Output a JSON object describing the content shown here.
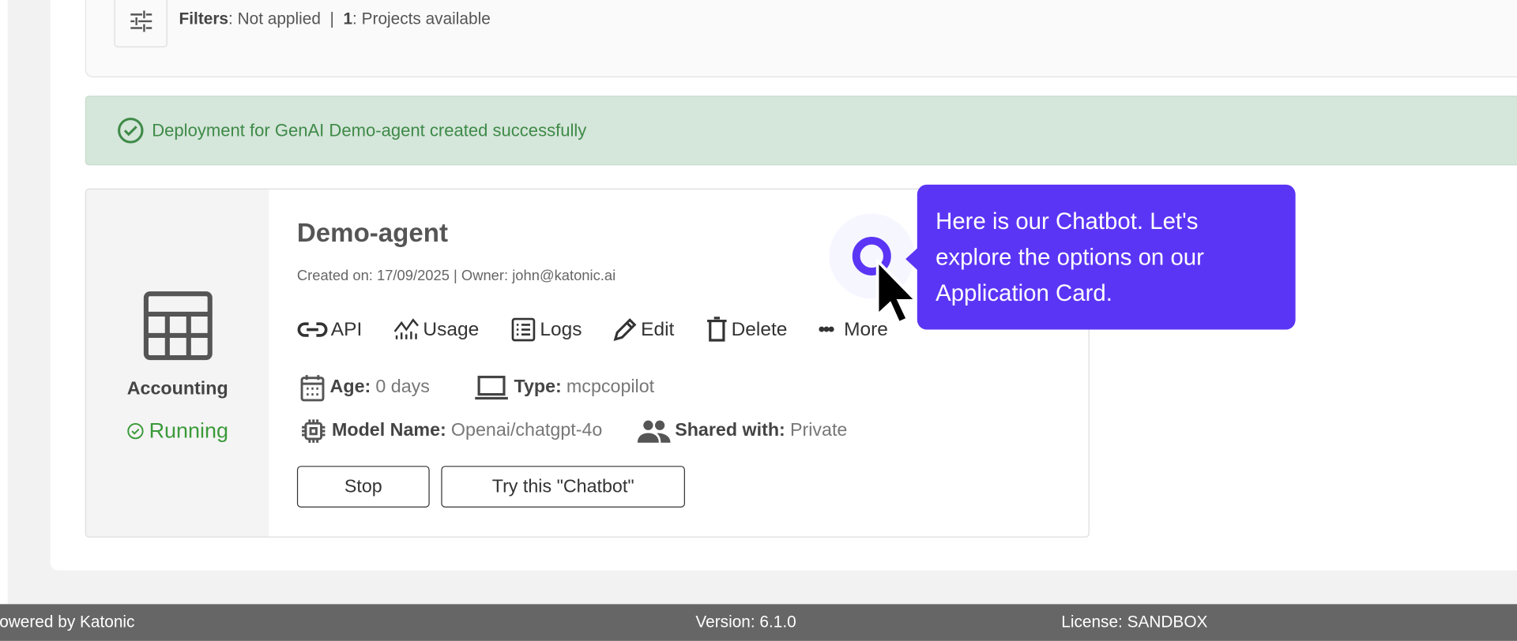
{
  "filters": {
    "label": "Filters",
    "value": ": Not applied",
    "sep": "|",
    "count": "1",
    "count_label": ": Projects available"
  },
  "alert": {
    "message": "Deployment for GenAI Demo-agent created successfully",
    "color": "#3e8a48"
  },
  "card": {
    "category": "Accounting",
    "status": "Running",
    "title": "Demo-agent",
    "meta": "Created on: 17/09/2025 | Owner: john@katonic.ai",
    "actions": [
      "API",
      "Usage",
      "Logs",
      "Edit",
      "Delete",
      "More"
    ],
    "age_label": "Age:",
    "age": "0 days",
    "type_label": "Type:",
    "type": "mcpcopilot",
    "model_label": "Model Name:",
    "model": "Openai/chatgpt-4o",
    "shared_label": "Shared with:",
    "shared": "Private",
    "stop": "Stop",
    "try": "Try this \"Chatbot\""
  },
  "tooltip": {
    "text": "Here is our Chatbot. Let's explore the options on our Application Card.",
    "color": "#5b35f5"
  },
  "footer": {
    "powered": "Powered by Katonic",
    "version": "Version: 6.1.0",
    "license": "License: SANDBOX"
  }
}
